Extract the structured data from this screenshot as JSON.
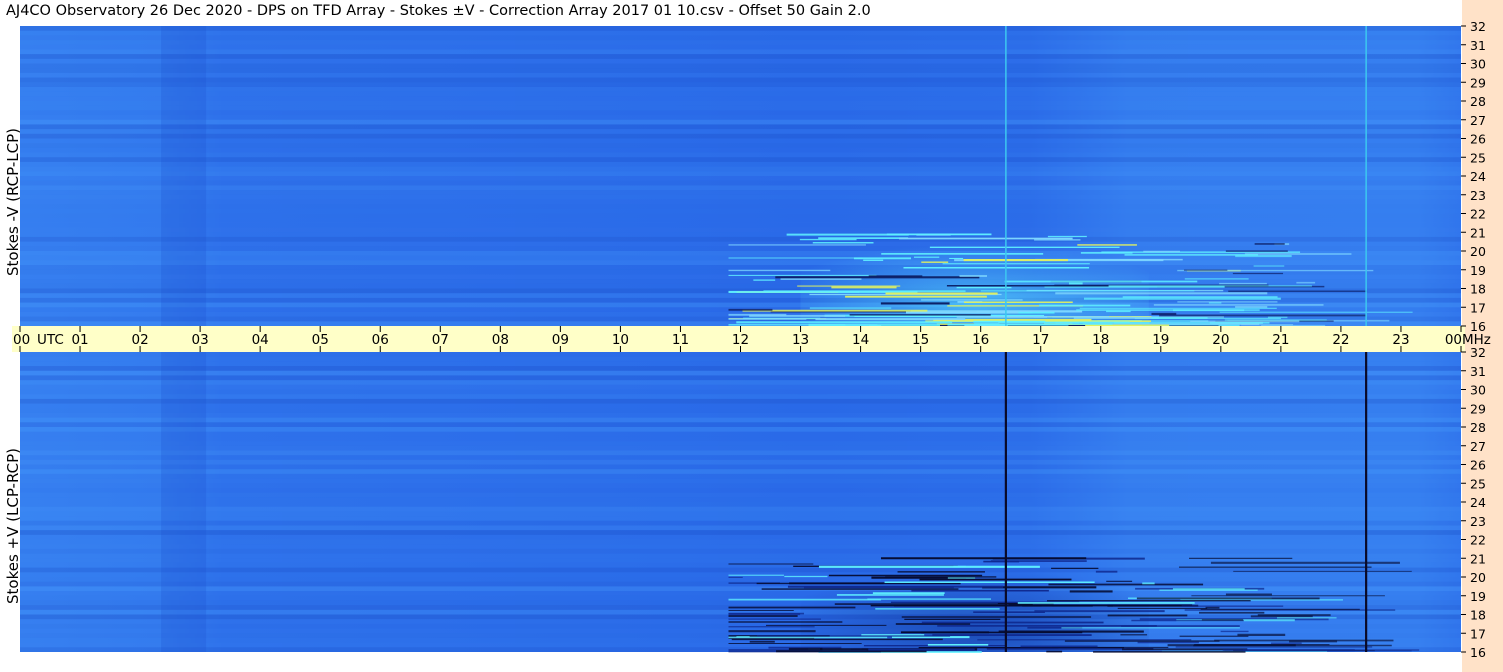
{
  "title": "AJ4CO Observatory  26 Dec 2020  -  DPS on TFD Array  -  Stokes ±V  -  Correction Array 2017 01 10.csv  -  Offset 50  Gain 2.0",
  "colors": {
    "background": "#ffffff",
    "time_axis_band": "#ffffc8",
    "frequency_strip": "#ffe2c8",
    "spectrogram_base": "#2a6ae8",
    "spectrogram_bright": "#4da6ff",
    "burst_cyan": "#5ff0ff",
    "burst_yellow": "#e0f060",
    "marker_top": "#3cc8f0",
    "marker_bottom": "#0a0a28"
  },
  "chart_data": {
    "type": "heatmap",
    "x_axis": {
      "label": "UTC",
      "range": [
        0,
        24
      ],
      "tick_labels": [
        "00",
        "01",
        "02",
        "03",
        "04",
        "05",
        "06",
        "07",
        "08",
        "09",
        "10",
        "11",
        "12",
        "13",
        "14",
        "15",
        "16",
        "17",
        "18",
        "19",
        "20",
        "21",
        "22",
        "23",
        "00"
      ]
    },
    "y_axis": {
      "unit": "MHz",
      "range": [
        16,
        32
      ],
      "tick_labels": [
        "16",
        "17",
        "18",
        "19",
        "20",
        "21",
        "22",
        "23",
        "24",
        "25",
        "26",
        "27",
        "28",
        "29",
        "30",
        "31",
        "32"
      ]
    },
    "panels": [
      {
        "name": "Stokes -V (RCP-LCP)",
        "position": "top",
        "marker_lines_utc": [
          16.42,
          22.42
        ],
        "marker_color": "#3cc8f0",
        "burst_activity": {
          "start_utc": 11.8,
          "end_utc": 23.8,
          "peak_utc": 15.7,
          "freq_range_mhz": [
            16,
            21
          ]
        }
      },
      {
        "name": "Stokes +V (LCP-RCP)",
        "position": "bottom",
        "marker_lines_utc": [
          16.42,
          22.42
        ],
        "marker_color": "#0a0a28",
        "burst_activity": {
          "start_utc": 11.8,
          "end_utc": 23.8,
          "peak_utc": 15.7,
          "freq_range_mhz": [
            16,
            21
          ]
        }
      }
    ]
  }
}
